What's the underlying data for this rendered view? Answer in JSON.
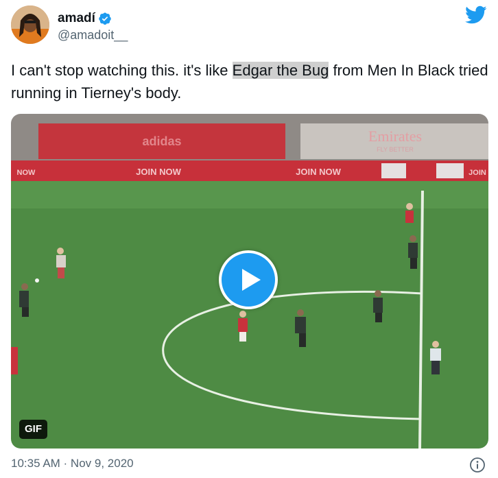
{
  "author": {
    "display_name": "amadí",
    "handle": "@amadoit__",
    "verified": true
  },
  "tweet": {
    "text_before": "I can't stop watching this. it's like ",
    "highlight": "Edgar the Bug",
    "text_after": " from Men In Black tried running in Tierney's body."
  },
  "media": {
    "badge": "GIF",
    "board_left": "NOW",
    "board_join_1": "JOIN NOW",
    "board_join_2": "JOIN NOW",
    "board_join_3": "JOIN",
    "stand_brand": "adidas",
    "stand_sponsor": "Emirates",
    "stand_tagline": "FLY BETTER"
  },
  "footer": {
    "timestamp": "10:35 AM · Nov 9, 2020"
  },
  "colors": {
    "twitter_blue": "#1d9bf0",
    "pitch_green": "#4e8b44",
    "board_red": "#c7303a",
    "text_secondary": "#536471"
  },
  "icons": [
    "verified-badge-icon",
    "twitter-bird-icon",
    "play-icon",
    "info-icon"
  ]
}
